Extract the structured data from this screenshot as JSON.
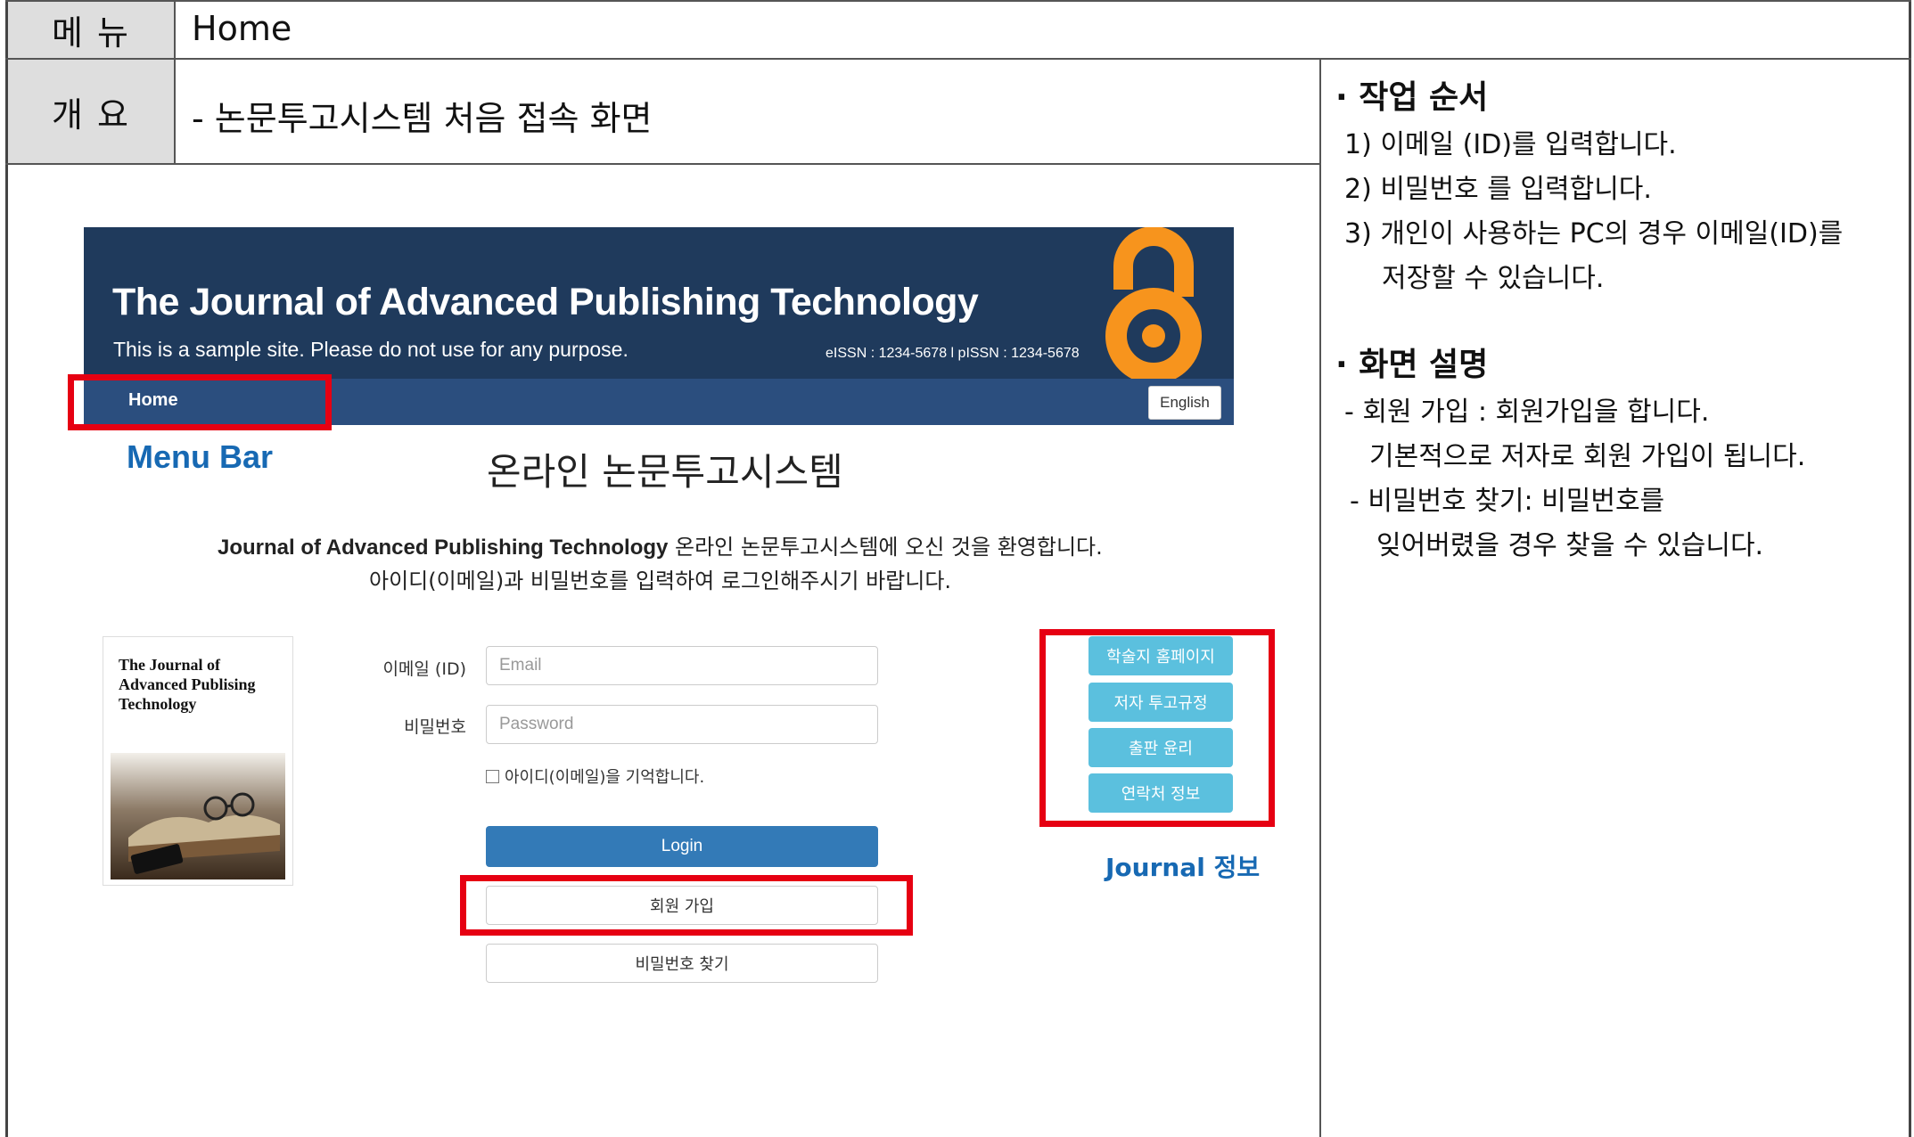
{
  "header": {
    "menu_label": "메 뉴",
    "menu_value": "Home",
    "overview_label": "개 요",
    "overview_value": "- 논문투고시스템 처음 접속 화면"
  },
  "notes": {
    "procedure_title": "· 작업 순서",
    "steps": [
      "1) 이메일 (ID)를 입력합니다.",
      "2) 비밀번호 를 입력합니다.",
      "3) 개인이 사용하는 PC의 경우 이메일(ID)를",
      "저장할 수 있습니다."
    ],
    "description_title": "· 화면 설명",
    "descriptions": [
      "- 회원 가입 : 회원가입을 합니다.",
      "기본적으로 저자로 회원 가입이 됩니다.",
      "- 비밀번호 찾기: 비밀번호를",
      "잊어버렸을 경우 찾을 수 있습니다."
    ]
  },
  "site": {
    "banner_title": "The Journal of Advanced Publishing Technology",
    "banner_subtitle": "This is a sample site. Please do not use for any purpose.",
    "issn": "eISSN : 1234-5678 l pISSN : 1234-5678",
    "nav_home": "Home",
    "nav_english": "English",
    "system_title": "온라인 논문투고시스템",
    "welcome_journal": "Journal of Advanced Publishing Technology",
    "welcome_rest": " 온라인 논문투고시스템에 오신 것을 환영합니다.",
    "welcome_line2": "아이디(이메일)과 비밀번호를 입력하여 로그인해주시기 바랍니다.",
    "cover_title": "The Journal of Advanced Publising Technology",
    "email_label": "이메일 (ID)",
    "email_placeholder": "Email",
    "password_label": "비밀번호",
    "password_placeholder": "Password",
    "remember_label": "아이디(이메일)을 기억합니다.",
    "login_button": "Login",
    "signup_button": "회원 가입",
    "find_password_button": "비밀번호 찾기",
    "journal_buttons": [
      "학술지 홈페이지",
      "저자 투고규정",
      "출판 윤리",
      "연락처 정보"
    ]
  },
  "annotations": {
    "menu_bar": "Menu Bar",
    "journal_info": "Journal 정보"
  },
  "colors": {
    "banner": "#1f3a5c",
    "navbar": "#2b4e7e",
    "accent_orange": "#f7941d",
    "login_blue": "#337ab7",
    "info_button": "#5bc0de",
    "highlight_red": "#e60012",
    "annotation_blue": "#1769b3"
  }
}
